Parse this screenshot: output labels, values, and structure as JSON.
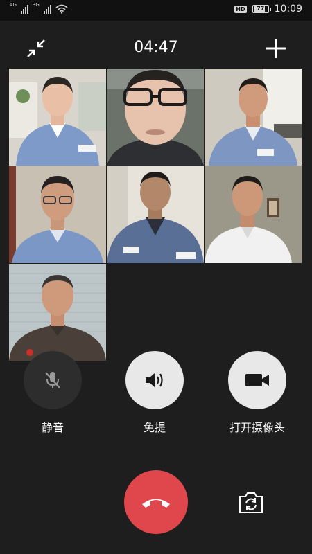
{
  "status_bar": {
    "sim1_network": "4G",
    "sim2_network": "3G",
    "hd_label": "HD",
    "battery_level": "77",
    "time": "10:09"
  },
  "call": {
    "duration": "04:47",
    "participant_count": 7
  },
  "controls": {
    "mute_label": "静音",
    "speaker_label": "免提",
    "camera_label": "打开摄像头"
  },
  "icons": {
    "minimize": "minimize-arrows-icon",
    "add": "plus-icon",
    "mute": "mic-off-icon",
    "speaker": "speaker-icon",
    "camera": "video-camera-icon",
    "hangup": "phone-hangup-icon",
    "switch_camera": "switch-camera-icon"
  },
  "colors": {
    "background": "#1e1e1e",
    "hangup": "#e0474c",
    "control_light": "#e8e8e8",
    "control_dark": "#2d2d2d"
  }
}
